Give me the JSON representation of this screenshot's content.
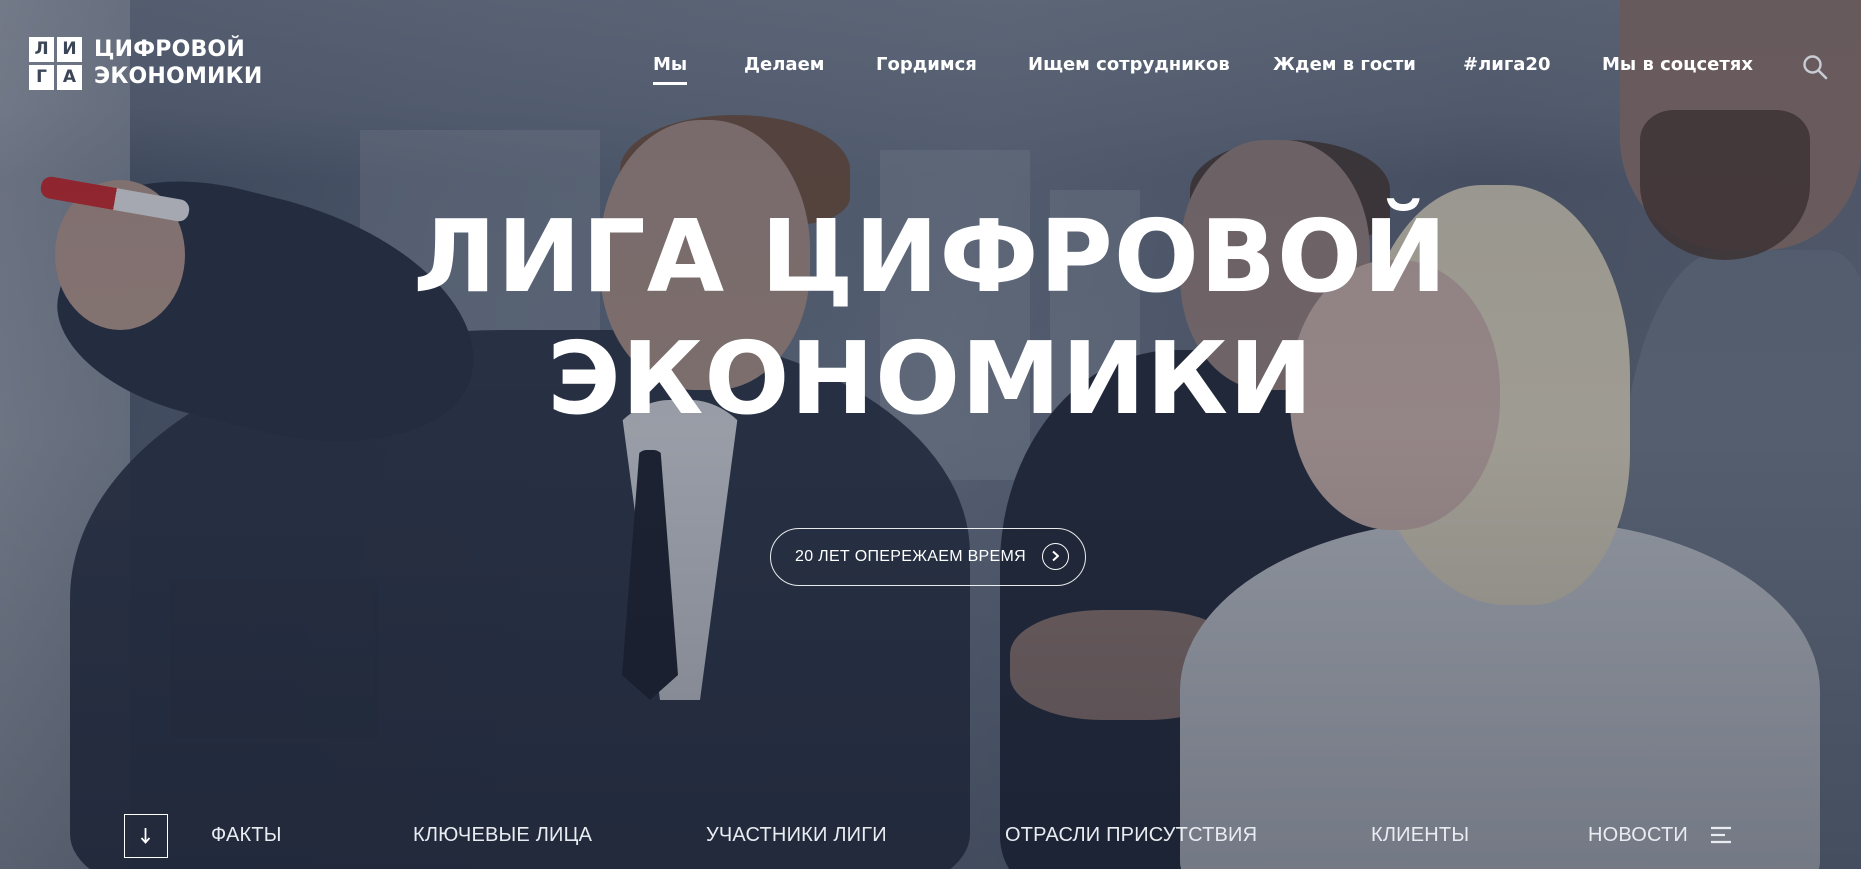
{
  "logo": {
    "mark_letters": [
      "Л",
      "И",
      "Г",
      "А"
    ],
    "line1": "ЦИФРОВОЙ",
    "line2": "ЭКОНОМИКИ"
  },
  "nav": {
    "items": [
      {
        "label": "Мы",
        "active": true
      },
      {
        "label": "Делаем",
        "active": false
      },
      {
        "label": "Гордимся",
        "active": false
      },
      {
        "label": "Ищем сотрудников",
        "active": false
      },
      {
        "label": "Ждем в гости",
        "active": false
      },
      {
        "label": "#лига20",
        "active": false
      },
      {
        "label": "Мы в соцсетях",
        "active": false
      }
    ],
    "search_icon": "search-icon"
  },
  "hero": {
    "title_line1": "ЛИГА ЦИФРОВОЙ",
    "title_line2": "ЭКОНОМИКИ",
    "cta_label": "20 ЛЕТ ОПЕРЕЖАЕМ ВРЕМЯ",
    "cta_icon": "play-circle-icon"
  },
  "bottom_nav": {
    "scroll_icon": "arrow-down-icon",
    "items": [
      "ФАКТЫ",
      "КЛЮЧЕВЫЕ ЛИЦА",
      "УЧАСТНИКИ ЛИГИ",
      "ОТРАСЛИ ПРИСУТСТВИЯ",
      "КЛИЕНТЫ",
      "НОВОСТИ"
    ],
    "menu_icon": "menu-icon"
  },
  "colors": {
    "text": "#ffffff",
    "overlay": "#1c2438",
    "logo_bg": "#ffffff",
    "logo_text_dark": "#3c4658"
  }
}
